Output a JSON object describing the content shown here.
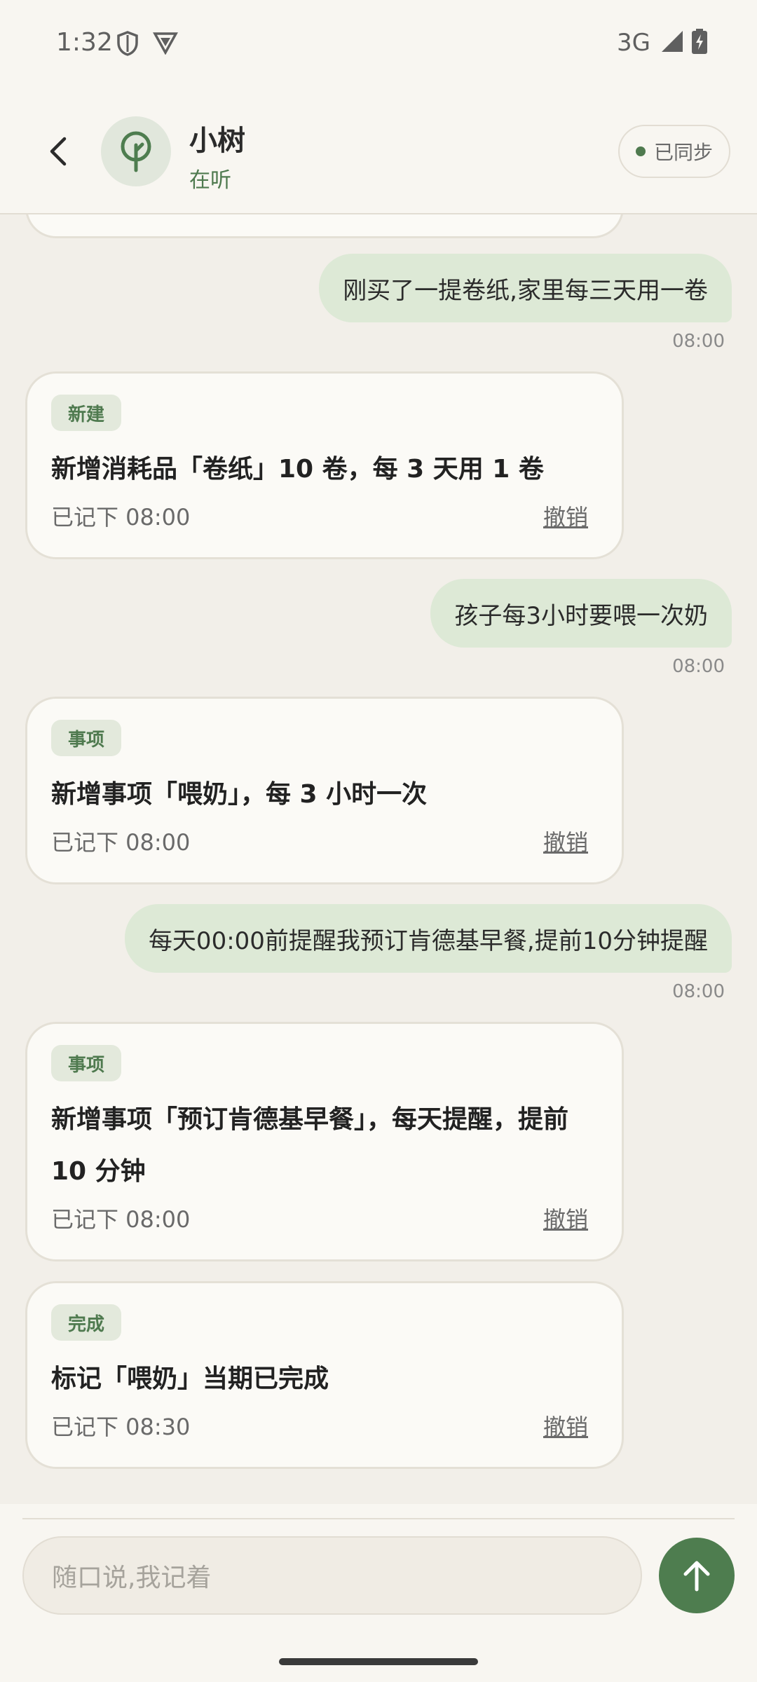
{
  "status_bar": {
    "time": "1:32",
    "network": "3G",
    "icons": [
      "shield-icon",
      "vpn-icon",
      "signal-icon",
      "battery-charging-icon"
    ]
  },
  "header": {
    "back_icon": "back-arrow-icon",
    "avatar_icon": "tree-icon",
    "name": "小树",
    "status": "在听",
    "sync_label": "已同步"
  },
  "messages": [
    {
      "type": "user",
      "text": "刚买了一提卷纸,家里每三天用一卷",
      "time": "08:00"
    },
    {
      "type": "card",
      "tag": "新建",
      "text": "新增消耗品「卷纸」10 卷，每 3 天用 1 卷",
      "footer": "已记下 08:00",
      "action": "撤销"
    },
    {
      "type": "user",
      "text": "孩子每3小时要喂一次奶",
      "time": "08:00"
    },
    {
      "type": "card",
      "tag": "事项",
      "text": "新增事项「喂奶」，每 3 小时一次",
      "footer": "已记下 08:00",
      "action": "撤销"
    },
    {
      "type": "user",
      "text": "每天00:00前提醒我预订肯德基早餐,提前10分钟提醒",
      "time": "08:00"
    },
    {
      "type": "card",
      "tag": "事项",
      "text": "新增事项「预订肯德基早餐」，每天提醒，提前 10 分钟",
      "footer": "已记下 08:00",
      "action": "撤销"
    },
    {
      "type": "card",
      "tag": "完成",
      "text": "标记「喂奶」当期已完成",
      "footer": "已记下 08:30",
      "action": "撤销"
    }
  ],
  "input": {
    "placeholder": "随口说,我记着",
    "send_icon": "arrow-up-icon"
  },
  "colors": {
    "accent": "#4e7d4f",
    "user_bubble": "#dde9d6",
    "background": "#f2efe9",
    "card": "#fbfaf6"
  }
}
